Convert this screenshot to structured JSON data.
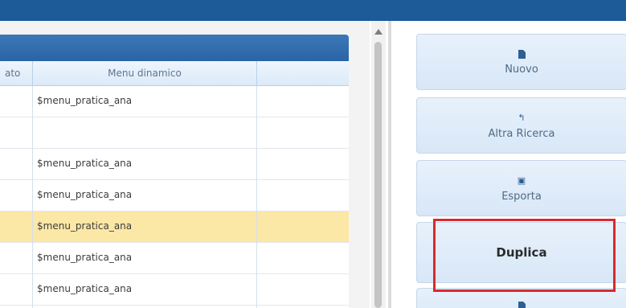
{
  "grid": {
    "headers": [
      "ato",
      "Menu dinamico"
    ],
    "rows": [
      {
        "value": "$menu_pratica_ana",
        "selected": false
      },
      {
        "value": "",
        "selected": false
      },
      {
        "value": "$menu_pratica_ana",
        "selected": false
      },
      {
        "value": "$menu_pratica_ana",
        "selected": false
      },
      {
        "value": "$menu_pratica_ana",
        "selected": true
      },
      {
        "value": "$menu_pratica_ana",
        "selected": false
      },
      {
        "value": "$menu_pratica_ana",
        "selected": false
      }
    ]
  },
  "actions": {
    "nuovo": {
      "label": "Nuovo",
      "icon": "document-icon"
    },
    "altra_ricerca": {
      "label": "Altra Ricerca",
      "icon": "undo-arrow-icon"
    },
    "esporta": {
      "label": "Esporta",
      "icon": "save-icon"
    },
    "duplica": {
      "label": "Duplica"
    },
    "next": {
      "icon": "document-icon"
    }
  },
  "colors": {
    "topbar": "#1c5a98",
    "highlight_border": "#d82b2b",
    "selected_row": "#fbe7a6"
  }
}
